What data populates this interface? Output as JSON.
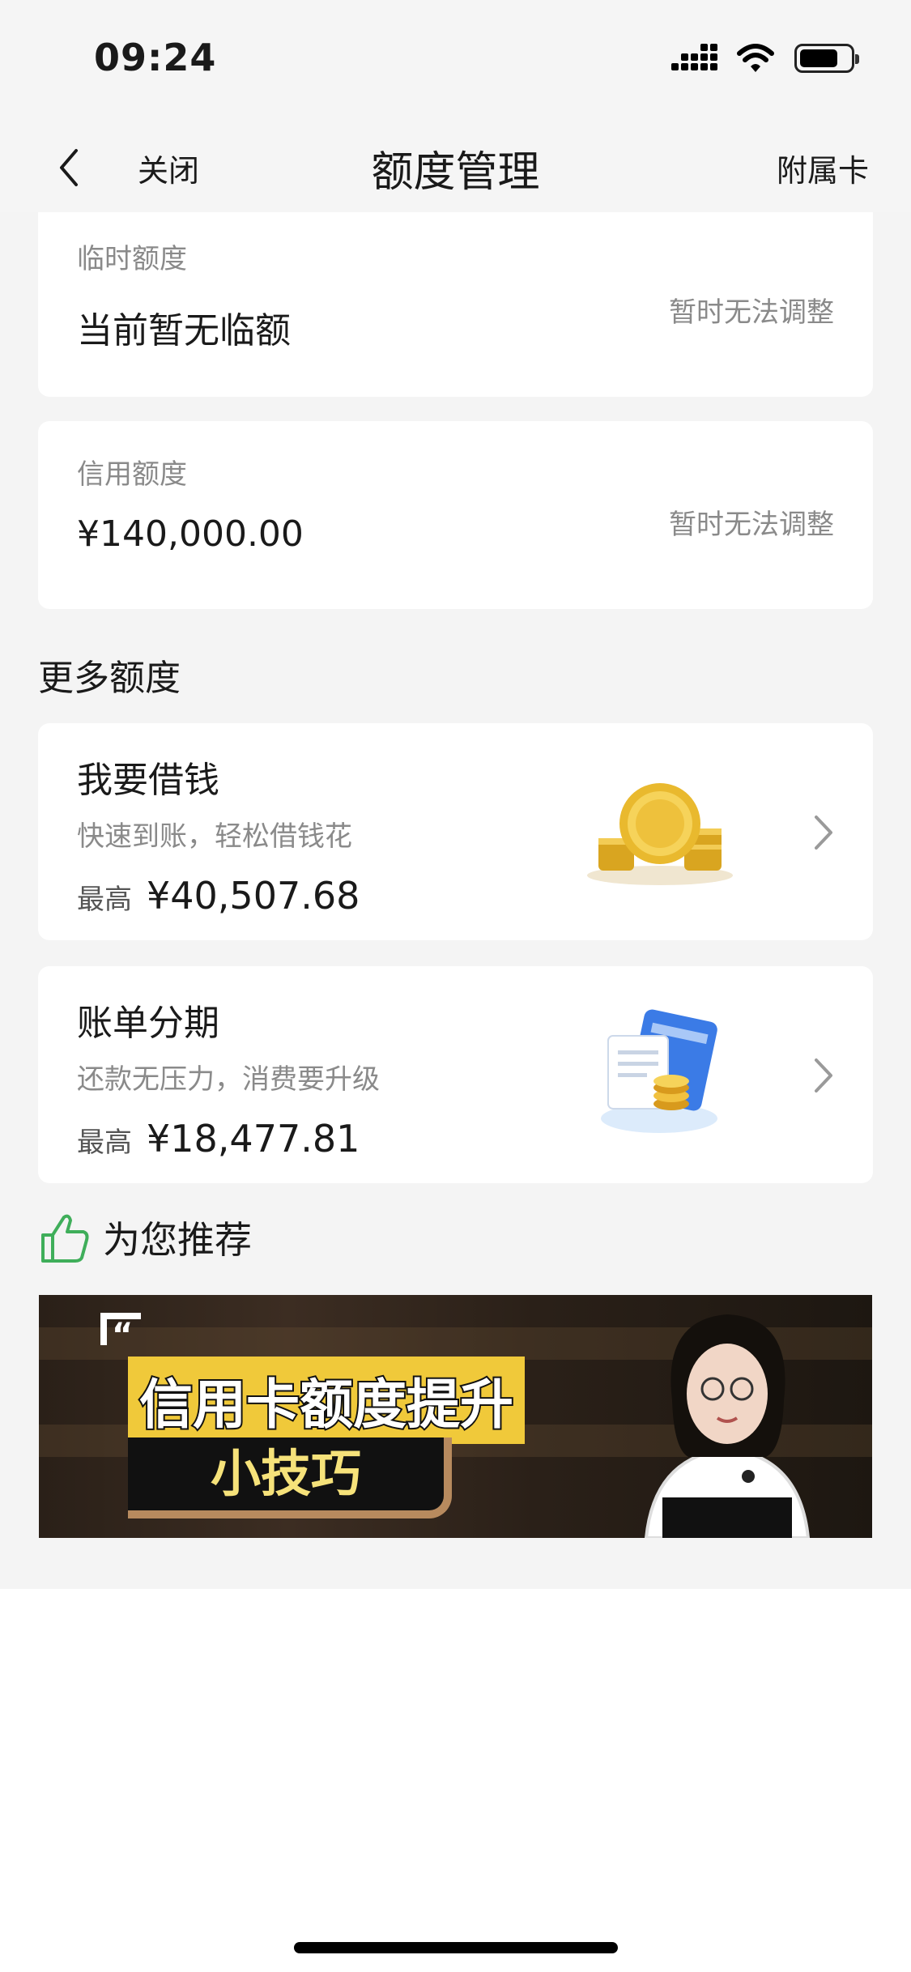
{
  "status_bar": {
    "time": "09:24"
  },
  "nav": {
    "close_label": "关闭",
    "title": "额度管理",
    "right_label": "附属卡"
  },
  "temp_limit": {
    "label": "临时额度",
    "value": "当前暂无临额",
    "note": "暂时无法调整"
  },
  "credit_limit": {
    "label": "信用额度",
    "value": "¥140,000.00",
    "note": "暂时无法调整"
  },
  "more_section": {
    "title": "更多额度"
  },
  "offers": [
    {
      "title": "我要借钱",
      "subtitle": "快速到账，轻松借钱花",
      "max_label": "最高",
      "amount": "¥40,507.68",
      "icon": "gold-coins-icon"
    },
    {
      "title": "账单分期",
      "subtitle": "还款无压力，消费要升级",
      "max_label": "最高",
      "amount": "¥18,477.81",
      "icon": "bill-card-icon"
    }
  ],
  "recommend": {
    "label": "为您推荐",
    "icon": "thumbs-up-icon"
  },
  "banner": {
    "line1": "信用卡额度提升",
    "line2": "小技巧"
  },
  "colors": {
    "accent_green": "#3fae5a",
    "background": "#f4f4f4",
    "card": "#ffffff",
    "muted_text": "#8a8a8a"
  }
}
